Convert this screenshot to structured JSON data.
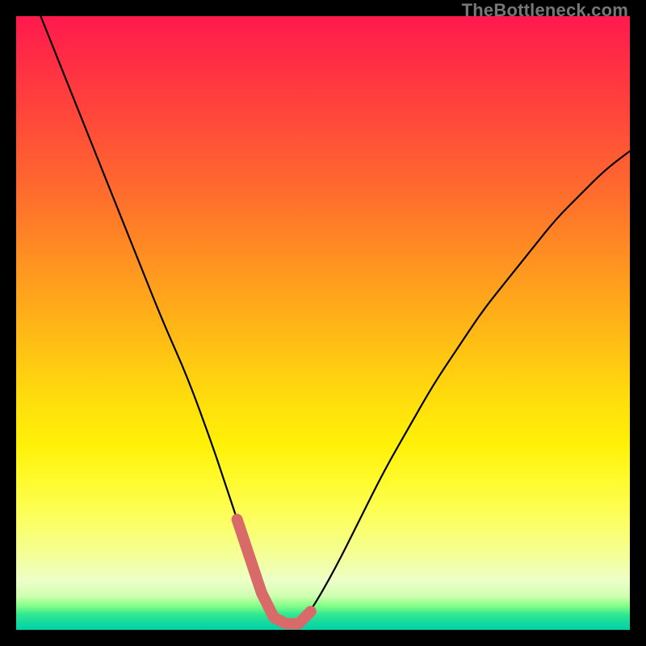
{
  "watermark": "TheBottleneck.com",
  "colors": {
    "background": "#000000",
    "gradient_top": "#ff1a4d",
    "gradient_mid": "#ffd400",
    "gradient_bottom": "#00d0a8",
    "curve_stroke": "#000000",
    "valley_stroke": "#d86a6a"
  },
  "chart_data": {
    "type": "line",
    "title": "",
    "xlabel": "",
    "ylabel": "",
    "xlim": [
      0,
      100
    ],
    "ylim": [
      0,
      100
    ],
    "grid": false,
    "legend": false,
    "series": [
      {
        "name": "bottleneck-curve",
        "x": [
          4,
          8,
          12,
          16,
          20,
          24,
          28,
          32,
          34,
          36,
          38,
          40,
          42,
          44,
          46,
          48,
          52,
          56,
          60,
          64,
          68,
          72,
          76,
          80,
          84,
          88,
          92,
          96,
          100
        ],
        "y": [
          100,
          90,
          80,
          70,
          60,
          50,
          41,
          30,
          24,
          18,
          12,
          6,
          2,
          1,
          1,
          3,
          10,
          18,
          26,
          33,
          40,
          46,
          52,
          57,
          62,
          67,
          71,
          75,
          78
        ]
      },
      {
        "name": "valley-highlight",
        "x": [
          36,
          38,
          40,
          42,
          44,
          46,
          48
        ],
        "y": [
          18,
          12,
          6,
          2,
          1,
          1,
          3
        ]
      }
    ],
    "annotations": []
  }
}
